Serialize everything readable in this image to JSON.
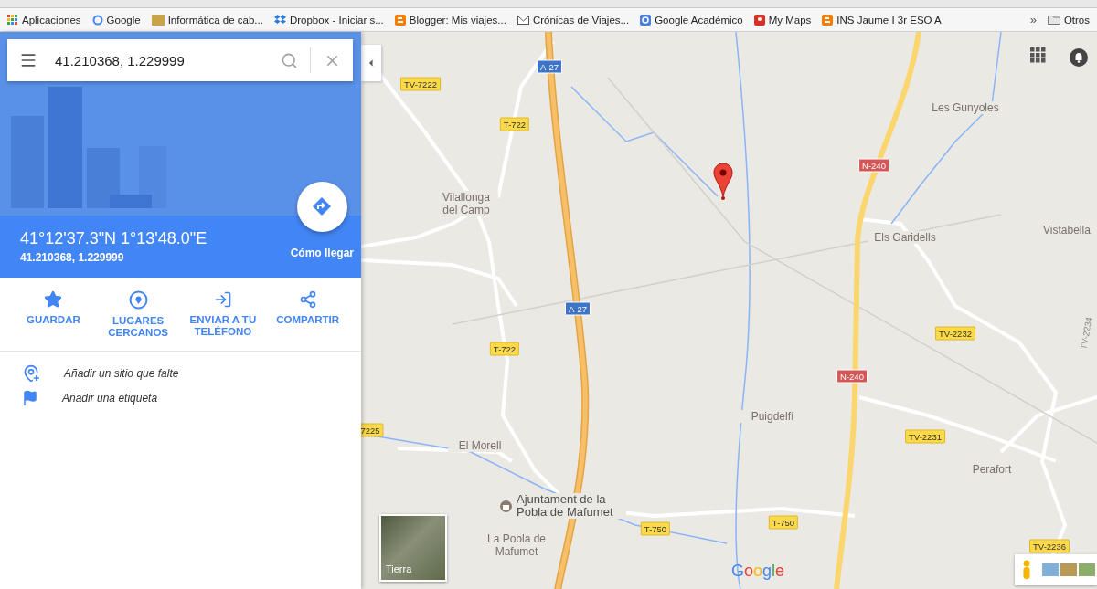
{
  "bookmarks": [
    {
      "label": "Aplicaciones",
      "kind": "apps"
    },
    {
      "label": "Google",
      "kind": "google"
    },
    {
      "label": "Informática de cab...",
      "kind": "site"
    },
    {
      "label": "Dropbox - Iniciar s...",
      "kind": "dropbox"
    },
    {
      "label": "Blogger: Mis viajes...",
      "kind": "blogger"
    },
    {
      "label": "Crónicas de Viajes...",
      "kind": "mail"
    },
    {
      "label": "Google Académico",
      "kind": "scholar"
    },
    {
      "label": "My Maps",
      "kind": "mymaps"
    },
    {
      "label": "INS Jaume I 3r ESO A",
      "kind": "blogger"
    }
  ],
  "bookmarks_overflow": "»",
  "other_bookmarks": "Otros",
  "search": {
    "value": "41.210368, 1.229999"
  },
  "place": {
    "dms": "41°12'37.3\"N 1°13'48.0\"E",
    "decimal": "41.210368, 1.229999",
    "directions": "Cómo llegar"
  },
  "actions": [
    {
      "label": "GUARDAR",
      "kind": "save"
    },
    {
      "label": "LUGARES CERCANOS",
      "kind": "nearby"
    },
    {
      "label": "ENVIAR A TU TELÉFONO",
      "kind": "send"
    },
    {
      "label": "COMPARTIR",
      "kind": "share"
    }
  ],
  "links": [
    {
      "label": "Añadir un sitio que falte",
      "kind": "add-place"
    },
    {
      "label": "Añadir una etiqueta",
      "kind": "label"
    }
  ],
  "map": {
    "road_shields": [
      {
        "label": "A-27",
        "kind": "motorway"
      },
      {
        "label": "TV-7222",
        "kind": "regional"
      },
      {
        "label": "T-722",
        "kind": "regional"
      },
      {
        "label": "N-240",
        "kind": "national"
      },
      {
        "label": "A-27",
        "kind": "motorway"
      },
      {
        "label": "TV-2232",
        "kind": "regional"
      },
      {
        "label": "T-722",
        "kind": "regional"
      },
      {
        "label": "N-240",
        "kind": "national"
      },
      {
        "label": "TV-2231",
        "kind": "regional"
      },
      {
        "label": "7225",
        "kind": "regional"
      },
      {
        "label": "T-750",
        "kind": "regional"
      },
      {
        "label": "T-750",
        "kind": "regional"
      },
      {
        "label": "TV-2236",
        "kind": "regional"
      },
      {
        "label": "TV-2234",
        "kind": "vertical"
      }
    ],
    "places": [
      {
        "name": "Les Gunyoles",
        "kind": "town"
      },
      {
        "name": "Vilallonga del Camp",
        "kind": "town"
      },
      {
        "name": "Els Garidells",
        "kind": "town"
      },
      {
        "name": "Vistabella",
        "kind": "town"
      },
      {
        "name": "Puigdelfí",
        "kind": "town"
      },
      {
        "name": "El Morell",
        "kind": "town"
      },
      {
        "name": "Ajuntament de la Pobla de Mafumet",
        "kind": "poi"
      },
      {
        "name": "La Pobla de Mafumet",
        "kind": "town"
      },
      {
        "name": "Perafort",
        "kind": "town"
      }
    ],
    "layer_label": "Tierra",
    "logo": "Google"
  }
}
